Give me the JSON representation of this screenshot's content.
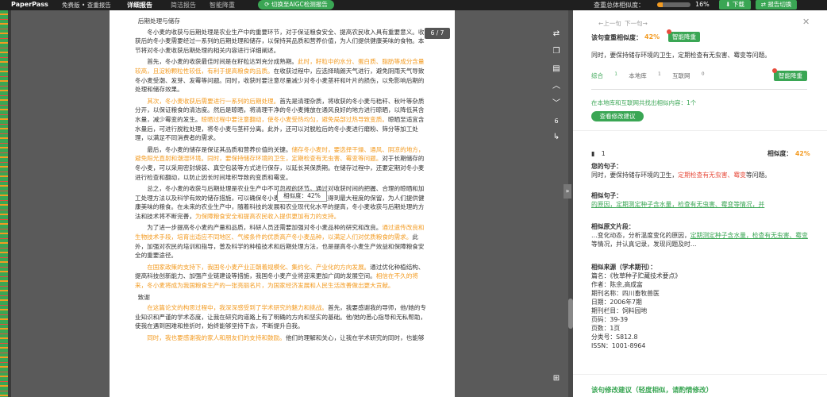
{
  "topbar": {
    "brand": "PaperPass",
    "edition": "免费版 • 查重报告",
    "tabs": [
      "详细报告",
      "简洁报告",
      "智能降重"
    ],
    "switch_label": "切换至AIGC检测报告",
    "similarity_label": "查重总体相似度：",
    "similarity_value": "16%",
    "similarity_fraction": 0.16,
    "download_label": "下载",
    "report_switch_label": "报告切换"
  },
  "doc": {
    "pager": "6 / 7",
    "tooltip": "相似度：42%",
    "paragraphs": [
      [
        {
          "t": "后期处理与储存",
          "c": ""
        }
      ],
      [
        {
          "t": "冬小麦的收获与后期处理是农业生产中的重要环节，对于保证粮食安全、提高农民收入具有重要意义。收获后的冬小麦需要经过一系列的后期处理和储存，以保持其品质和营养价值，为人们提供健康美味的食物。本节将对冬小麦收获后期处理的相关内容进行详细阐述。",
          "c": ""
        }
      ],
      [
        {
          "t": "首先，冬小麦的收获最佳时间是在籽粒达到充分成熟期。",
          "c": ""
        },
        {
          "t": "此时，籽粒中的水分、蛋白质、脂肪等成分含量较高，且淀粉颗粒性较低，有利于提高粮食的品质。",
          "c": "or"
        },
        {
          "t": "在收获过程中，应选择晴朗天气进行，避免阴雨天气导致冬小麦受潮、发芽、发霉等问题。同时，收获时要注意尽量减少对冬小麦茎秆和叶片的损伤，以免影响后期的处理和储存效果。",
          "c": ""
        }
      ],
      [
        {
          "t": "其次，冬小麦收获后需要进行一系列的后期处理。",
          "c": "or"
        },
        {
          "t": "首先是清理杂质，将收获的冬小麦与秸秆、秋叶等杂质分开，以保证粮食的清洁度。然后是晾晒，将清理干净的冬小麦摊放在通风良好的地方进行晾晒，以降低其含水量，减少霉变的发生。",
          "c": ""
        },
        {
          "t": "晾晒过程中要注意翻动，使冬小麦受热均匀，避免局部过热导致变质。",
          "c": "or"
        },
        {
          "t": "晾晒至适宜含水量后，可进行脱粒处理，将冬小麦与茎秆分离。此外，还可以对脱粒后的冬小麦进行磨粉、筛分等加工处理，以满足不同消费者的需求。",
          "c": ""
        }
      ],
      [
        {
          "t": "最后，冬小麦的储存是保证其品质和营养价值的关键。",
          "c": ""
        },
        {
          "t": "储存冬小麦时，要选择干燥、通风、阴凉的地方，避免阳光直射和潮湿环境。",
          "c": "or"
        },
        {
          "t": "同时，要保持储存环境的卫生，定期检查有无虫害、霉变等问题。",
          "c": "or"
        },
        {
          "t": "对于长期储存的冬小麦，可以采用密封袋装、真空包装等方式进行保存，以延长其保质期。在储存过程中，还要定期对冬小麦进行检查和翻动，以防止因长时间堆积导致的变质和霉变。",
          "c": ""
        }
      ],
      [
        {
          "t": "总之，冬小麦的收获与后期处理是农业生产中不可忽视的环节。通过对收获时间的把握、合理的晾晒和加工处理方法以及科学有效的储存措施，可以确保冬小麦的品质和营养价值得到最大程度的保留，为人们提供健康美味的粮食。在未来的农业生产中，随着科技的发展和农业现代化水平的提高，冬小麦收获与后期处理的方法和技术将不断完善，",
          "c": ""
        },
        {
          "t": "为保障粮食安全和提高农民收入提供更加有力的支持。",
          "c": "or"
        }
      ],
      [
        {
          "t": "为了进一步提高冬小麦的产量和品质，科研人员还需要加强对冬小麦品种的研究和改良。",
          "c": ""
        },
        {
          "t": "通过遗传改良和生物技术手段，培育出适应不同地区、气候条件的优质高产冬小麦品种，以满足人们对优质粮食的需求。",
          "c": "or"
        },
        {
          "t": "此外，加强对农民的培训和指导，普及科学的种植技术和后期处理方法，也是提高冬小麦生产效益和保障粮食安全的重要途径。",
          "c": ""
        }
      ],
      [
        {
          "t": "在国家政策的支持下，我国冬小麦产业正朝着规模化、集约化、产业化的方向发展。",
          "c": "or"
        },
        {
          "t": "通过优化种植结构、提高科技创新能力、加强产业链建设等措施，我国冬小麦产业将迎来更加广阔的发展空间。",
          "c": ""
        },
        {
          "t": "相信在不久的将来，冬小麦将成为我国粮食生产的一张亮丽名片，为国家经济发展和人民生活改善做出更大贡献。",
          "c": "or"
        }
      ],
      [
        {
          "t": "致谢",
          "c": ""
        }
      ],
      [
        {
          "t": "在这篇论文的构思过程中，我深深感受到了学术研究的魅力和挑战。",
          "c": "or"
        },
        {
          "t": "首先，我要感谢我的导师，他/她的专业知识和严谨的学术态度，让我在研究的道路上有了明确的方向和坚实的基础。他/她的悉心指导和无私帮助，使我在遇到困难和挫折时，始终能够坚持下去，不断提升自我。",
          "c": ""
        }
      ],
      [
        {
          "t": "同时，我也要感谢我的家人和朋友们的支持和鼓励。",
          "c": "or"
        },
        {
          "t": "他们的理解和关心，让我在学术研究的同时，也能够",
          "c": ""
        }
      ]
    ]
  },
  "panel": {
    "prev": "←上一句",
    "next": "下一句→",
    "sentence_sim_label": "该句查重相似度：",
    "sentence_sim_value": "42%",
    "reduce_label": "智能降重",
    "sentence": "同时，要保持储存环境的卫生，定期检查有无虫害、霉变等问题。",
    "tabs": [
      {
        "label": "综合",
        "count": "1"
      },
      {
        "label": "本地库",
        "count": "1"
      },
      {
        "label": "互联网",
        "count": "0"
      }
    ],
    "found_text": "在本地库和互联网共找出相似内容：1个",
    "suggest_button": "查看修改建议",
    "result_index": "1",
    "result_sim_label": "相似度：",
    "result_sim_value": "42%",
    "your_sentence_label": "您的句子：",
    "your_sentence_parts": [
      "同时，要保持储存环境的卫生，",
      "定期检查有无虫害、霉变",
      "等问题。"
    ],
    "similar_sentence_label": "相似句子：",
    "similar_sentence_parts": [
      "的原因，",
      "定期测定种子含水量，检查有无虫害、霉变",
      "等情况，并"
    ],
    "similar_context_label": "相似原文片段：",
    "similar_context_parts": [
      "…变化动态，分析温度变化的原因，",
      "定期测定种子含水量，检查有无虫害、霉变",
      "等情况，并认真记录，发现问题及时…"
    ],
    "source_label": "相似来源（学术期刊）：",
    "source_lines": [
      "篇名：《牧草种子贮藏技术要点》",
      "作者：陈余,高成富",
      "期刊名称：四川畜牧兽医",
      "日期：2006年7期",
      "期刊栏目：饲料园地",
      "页码：39-39",
      "页数：1页",
      "分类号：S812.8",
      "ISSN：1001-8964"
    ],
    "footer": "该句修改建议（轻度相似，请酌情修改）"
  },
  "colors": {
    "green": "#3aa654",
    "orange": "#f39b21",
    "red": "#e74c3c"
  }
}
